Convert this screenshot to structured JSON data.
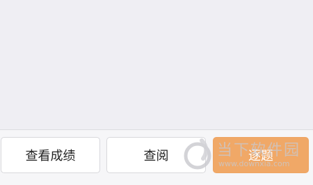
{
  "bottom_bar": {
    "results_label": "查看成绩",
    "review_label": "查阅",
    "next_label": "逐题"
  },
  "watermark": {
    "title": "当下软件园",
    "url": "www.downxia.com"
  },
  "colors": {
    "background": "#efeef3",
    "accent": "#f0a867"
  }
}
